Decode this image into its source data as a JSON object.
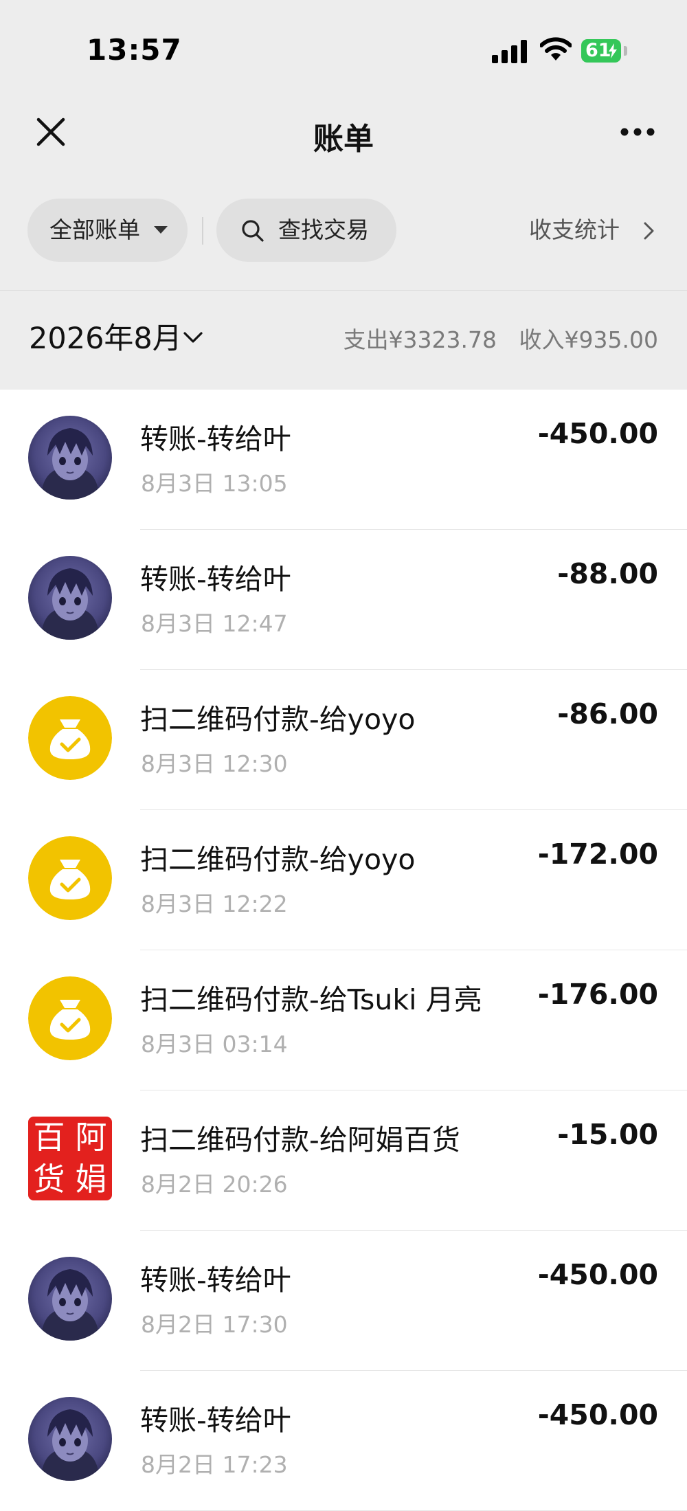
{
  "status_bar": {
    "time": "13:57",
    "battery": "61",
    "icons": [
      "signal-icon",
      "wifi-icon",
      "battery-charging-icon"
    ]
  },
  "nav": {
    "title": "账单",
    "left_icon": "close-icon",
    "right_icon": "more-icon"
  },
  "filters": {
    "all_bills": "全部账单",
    "search": "查找交易",
    "stats": "收支统计"
  },
  "month": {
    "label": "2026年8月",
    "expense": "支出¥3323.78",
    "income": "收入¥935.00"
  },
  "colors": {
    "header_bg": "#ededed",
    "pill_bg": "#e0e0e0",
    "wallet_yellow": "#f2c300",
    "seal_red": "#e3211e",
    "avatar_purple": "#3a3a6e"
  },
  "transactions": [
    {
      "title": "转账-转给叶",
      "time": "8月3日 13:05",
      "amount": "-450.00",
      "avatar": "anime-avatar"
    },
    {
      "title": "转账-转给叶",
      "time": "8月3日 12:47",
      "amount": "-88.00",
      "avatar": "anime-avatar"
    },
    {
      "title": "扫二维码付款-给yoyo",
      "time": "8月3日 12:30",
      "amount": "-86.00",
      "avatar": "money-bag-icon"
    },
    {
      "title": "扫二维码付款-给yoyo",
      "time": "8月3日 12:22",
      "amount": "-172.00",
      "avatar": "money-bag-icon"
    },
    {
      "title": "扫二维码付款-给Tsuki 月亮",
      "time": "8月3日 03:14",
      "amount": "-176.00",
      "avatar": "money-bag-icon"
    },
    {
      "title": "扫二维码付款-给阿娟百货",
      "time": "8月2日 20:26",
      "amount": "-15.00",
      "avatar": "seal-avatar",
      "seal_text": [
        "百",
        "阿",
        "货",
        "娟"
      ]
    },
    {
      "title": "转账-转给叶",
      "time": "8月2日 17:30",
      "amount": "-450.00",
      "avatar": "anime-avatar"
    },
    {
      "title": "转账-转给叶",
      "time": "8月2日 17:23",
      "amount": "-450.00",
      "avatar": "anime-avatar"
    }
  ]
}
